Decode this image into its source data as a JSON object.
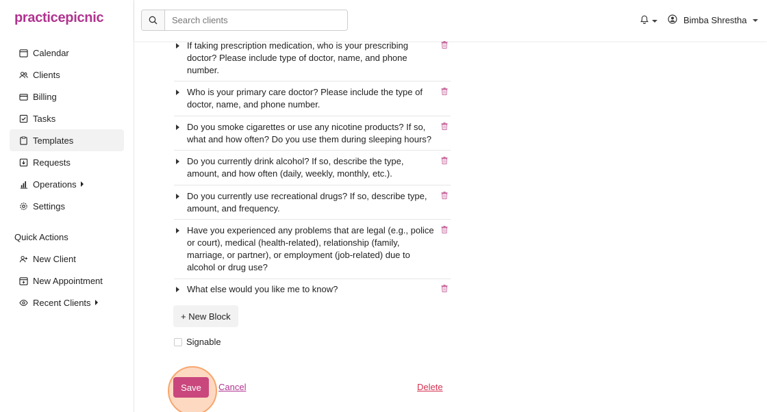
{
  "app": {
    "logo": "practicepicnic",
    "brand_color": "#b0338f"
  },
  "search": {
    "placeholder": "Search clients"
  },
  "user": {
    "name": "Bimba Shrestha"
  },
  "sidebar": {
    "items": [
      {
        "label": "Calendar",
        "icon": "calendar-icon"
      },
      {
        "label": "Clients",
        "icon": "users-icon"
      },
      {
        "label": "Billing",
        "icon": "credit-card-icon"
      },
      {
        "label": "Tasks",
        "icon": "checkbox-icon"
      },
      {
        "label": "Templates",
        "icon": "clipboard-icon",
        "active": true
      },
      {
        "label": "Requests",
        "icon": "inbox-icon"
      },
      {
        "label": "Operations",
        "icon": "bar-chart-icon"
      },
      {
        "label": "Settings",
        "icon": "gear-icon"
      }
    ],
    "quick_actions_label": "Quick Actions",
    "quick_actions": [
      {
        "label": "New Client",
        "icon": "user-plus-icon"
      },
      {
        "label": "New Appointment",
        "icon": "calendar-plus-icon"
      },
      {
        "label": "Recent Clients",
        "icon": "eye-icon"
      }
    ]
  },
  "questions": [
    "If taking prescription medication, who is your prescribing doctor? Please include type of doctor, name, and phone number.",
    "Who is your primary care doctor? Please include the type of doctor, name, and phone number.",
    "Do you smoke cigarettes or use any nicotine products? If so, what and how often? Do you use them during sleeping hours?",
    "Do you currently drink alcohol? If so, describe the type, amount, and how often (daily, weekly, monthly, etc.).",
    "Do you currently use recreational drugs? If so, describe type, amount, and frequency.",
    "Have you experienced any problems that are legal (e.g., police or court), medical (health-related), relationship (family, marriage, or partner), or employment (job-related) due to alcohol or drug use?",
    "What else would you like me to know?"
  ],
  "actions": {
    "new_block": "+ New Block",
    "signable": "Signable",
    "save": "Save",
    "cancel": "Cancel",
    "delete": "Delete"
  }
}
